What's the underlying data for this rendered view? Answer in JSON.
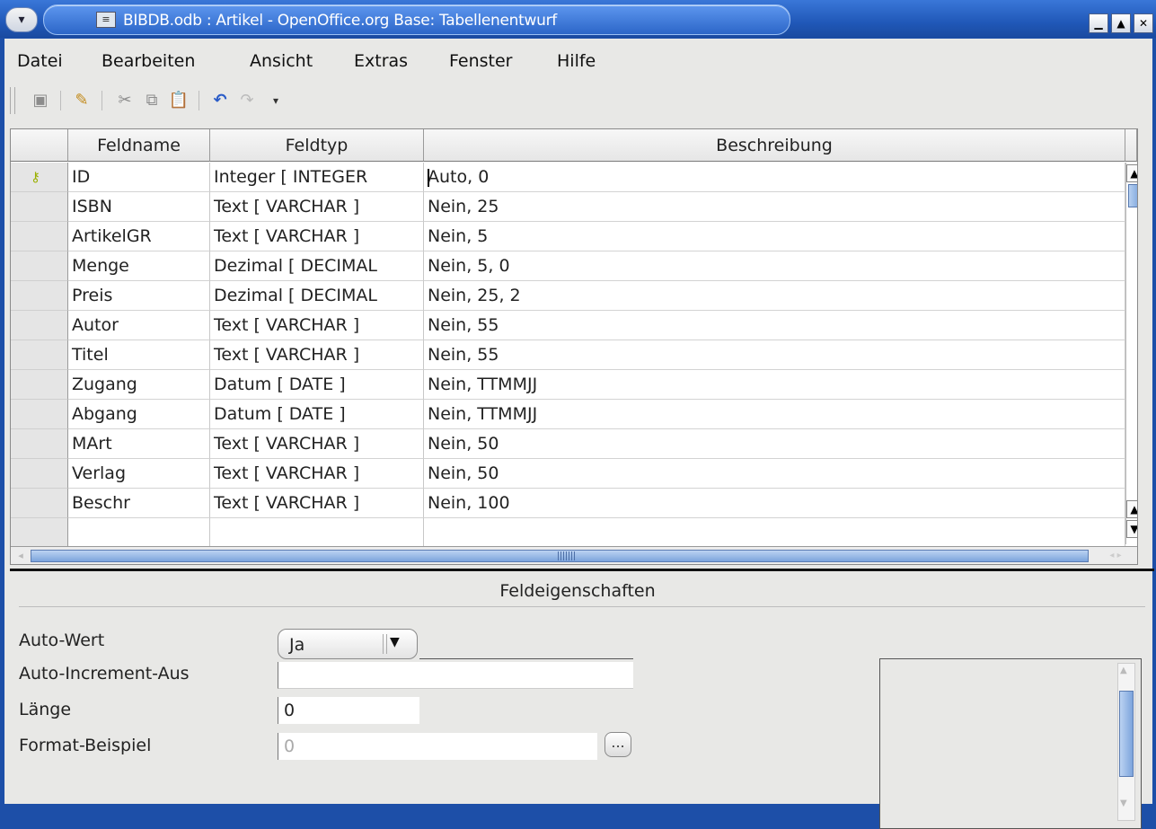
{
  "window": {
    "title": "BIBDB.odb : Artikel - OpenOffice.org Base: Tabellenentwurf",
    "app_icon": "openoffice-base-icon",
    "title_menu_icon": "▾",
    "controls": {
      "minimize": "▁",
      "maximize": "▲",
      "close": "✕"
    }
  },
  "menu": {
    "items": [
      "Datei",
      "Bearbeiten",
      "Ansicht",
      "Extras",
      "Fenster",
      "Hilfe"
    ]
  },
  "toolbar": {
    "buttons": [
      {
        "name": "save-icon",
        "glyph": "▣"
      },
      {
        "name": "edit-icon",
        "glyph": "✎"
      },
      {
        "name": "cut-icon",
        "glyph": "✂"
      },
      {
        "name": "copy-icon",
        "glyph": "⧉"
      },
      {
        "name": "paste-icon",
        "glyph": "📋"
      },
      {
        "name": "undo-icon",
        "glyph": "↶"
      },
      {
        "name": "redo-icon",
        "glyph": "↷"
      }
    ]
  },
  "grid": {
    "columns": [
      "Feldname",
      "Feldtyp",
      "Beschreibung"
    ],
    "rows": [
      {
        "name": "ID",
        "type": "Integer [ INTEGER",
        "desc": "Auto, 0"
      },
      {
        "name": "ISBN",
        "type": "Text [ VARCHAR ]",
        "desc": "Nein, 25"
      },
      {
        "name": "ArtikelGR",
        "type": "Text [ VARCHAR ]",
        "desc": "Nein, 5"
      },
      {
        "name": "Menge",
        "type": "Dezimal [ DECIMAL",
        "desc": "Nein, 5, 0"
      },
      {
        "name": "Preis",
        "type": "Dezimal [ DECIMAL",
        "desc": "Nein, 25, 2"
      },
      {
        "name": "Autor",
        "type": "Text [ VARCHAR ]",
        "desc": "Nein, 55"
      },
      {
        "name": "Titel",
        "type": "Text [ VARCHAR ]",
        "desc": "Nein, 55"
      },
      {
        "name": "Zugang",
        "type": "Datum [ DATE ]",
        "desc": "Nein, TTMMJJ"
      },
      {
        "name": "Abgang",
        "type": "Datum [ DATE ]",
        "desc": "Nein, TTMMJJ"
      },
      {
        "name": "MArt",
        "type": "Text [ VARCHAR ]",
        "desc": "Nein, 50"
      },
      {
        "name": "Verlag",
        "type": "Text [ VARCHAR ]",
        "desc": "Nein, 50"
      },
      {
        "name": "Beschr",
        "type": "Text [ VARCHAR ]",
        "desc": "Nein, 100"
      },
      {
        "name": "",
        "type": "",
        "desc": ""
      }
    ]
  },
  "properties": {
    "title": "Feldeigenschaften",
    "auto_wert_label": "Auto-Wert",
    "auto_wert_value": "Ja",
    "auto_increment_label": "Auto-Increment-Aus",
    "auto_increment_value": "",
    "laenge_label": "Länge",
    "laenge_value": "0",
    "format_label": "Format-Beispiel",
    "format_value": "0",
    "format_button": "..."
  }
}
